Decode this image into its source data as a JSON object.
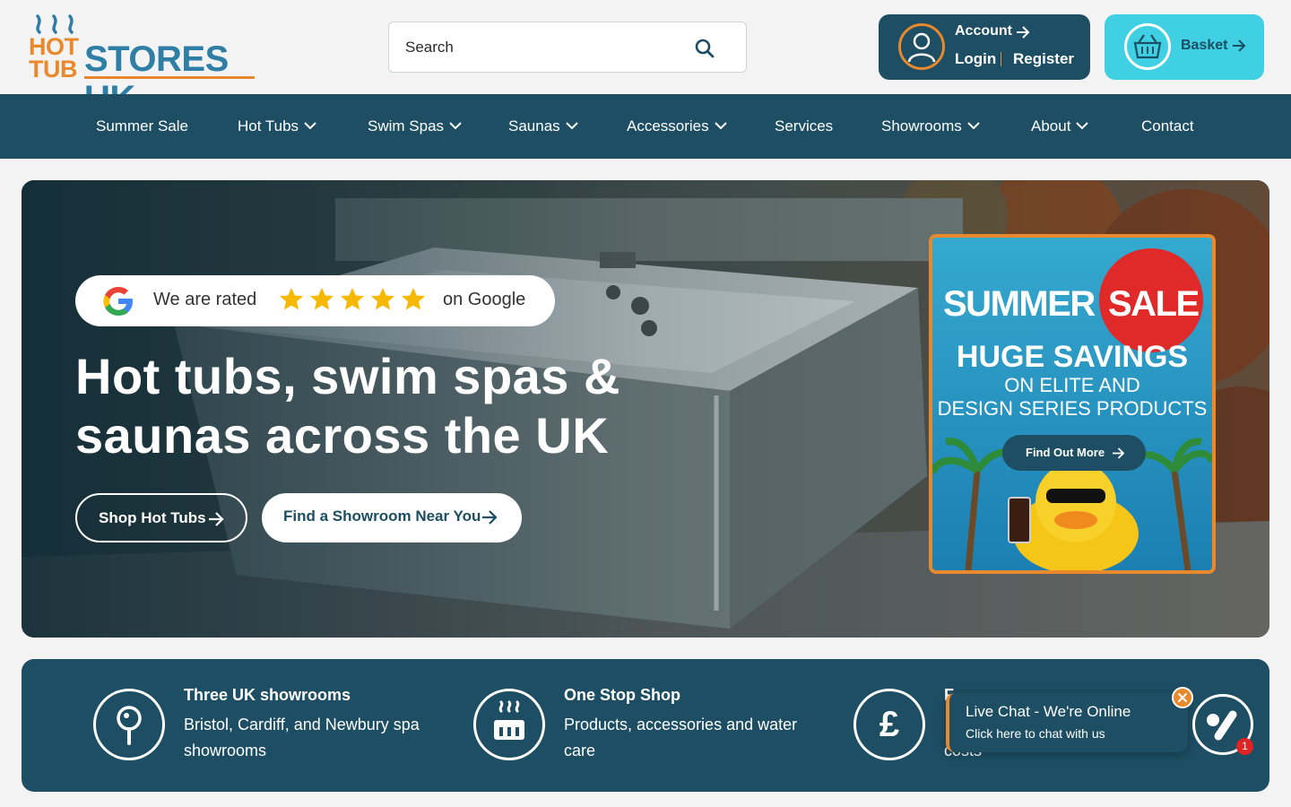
{
  "header": {
    "logo": {
      "hot": "HOT",
      "tub": "TUB",
      "stores": "STORES UK"
    },
    "search": {
      "placeholder": "Search"
    },
    "account": {
      "label": "Account",
      "login": "Login",
      "register": "Register"
    },
    "basket": {
      "label": "Basket"
    }
  },
  "nav": {
    "items": [
      {
        "label": "Summer Sale",
        "has_dropdown": false
      },
      {
        "label": "Hot Tubs",
        "has_dropdown": true
      },
      {
        "label": "Swim Spas",
        "has_dropdown": true
      },
      {
        "label": "Saunas",
        "has_dropdown": true
      },
      {
        "label": "Accessories",
        "has_dropdown": true
      },
      {
        "label": "Services",
        "has_dropdown": false
      },
      {
        "label": "Showrooms",
        "has_dropdown": true
      },
      {
        "label": "About",
        "has_dropdown": true
      },
      {
        "label": "Contact",
        "has_dropdown": false
      }
    ]
  },
  "hero": {
    "rating": {
      "prefix": "We are rated",
      "stars": 5,
      "suffix": "on Google"
    },
    "headline": "Hot tubs, swim spas & saunas across the UK",
    "buttons": {
      "shop": "Shop Hot Tubs",
      "showroom": "Find a Showroom Near You"
    },
    "promo": {
      "summer": "SUMMER",
      "sale": "SALE",
      "huge": "HUGE SAVINGS",
      "line1": "ON ELITE AND",
      "line2": "DESIGN SERIES PRODUCTS",
      "cta": "Find Out More"
    }
  },
  "features": [
    {
      "title": "Three UK showrooms",
      "desc": "Bristol, Cardiff, and Newbury spa showrooms",
      "icon": "pin-icon"
    },
    {
      "title": "One Stop Shop",
      "desc": "Products, accessories and water care",
      "icon": "hot-tub-icon"
    },
    {
      "title": "F",
      "desc": "costs",
      "icon": "pound-icon"
    }
  ],
  "chat": {
    "title": "Live Chat - We're Online",
    "subtitle": "Click here to chat with us",
    "badge": "1"
  },
  "colors": {
    "brand_dark": "#1d4e63",
    "brand_orange": "#e9892e",
    "brand_cyan": "#3fd0e3",
    "star": "#f6b900"
  }
}
